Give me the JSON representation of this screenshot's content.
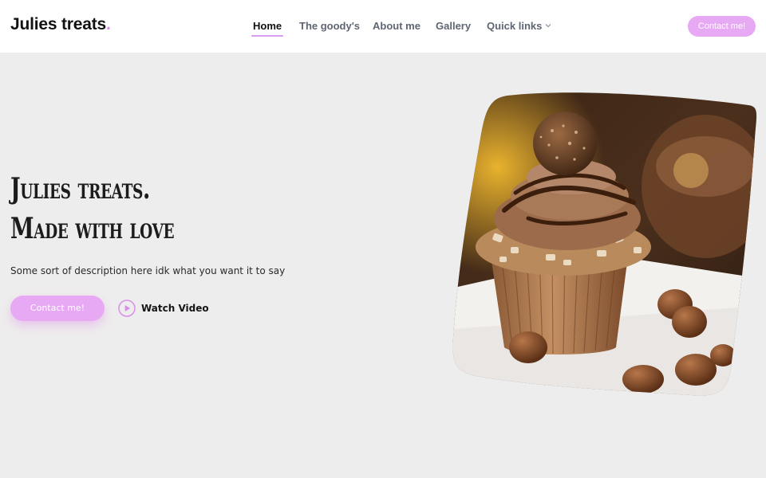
{
  "brand": {
    "name": "Julies treats",
    "dot": ".",
    "accent": "#d98de8"
  },
  "nav": {
    "items": [
      {
        "label": "Home",
        "active": true
      },
      {
        "label": "The goody's",
        "active": false
      },
      {
        "label": "About me",
        "active": false
      },
      {
        "label": "Gallery",
        "active": false
      },
      {
        "label": "Quick links",
        "active": false,
        "icon": "chevron-down-icon"
      }
    ]
  },
  "header": {
    "cta_label": "Contact me!"
  },
  "hero": {
    "title_line1": "Julies treats.",
    "title_line2": "Made with love",
    "description": "Some sort of description here idk what you want it to say",
    "cta_label": "Contact me!",
    "video_label": "Watch Video",
    "video_icon": "play-circle-icon",
    "image_subject": "chocolate hazelnut cupcake"
  },
  "colors": {
    "button": "#e7a9f3",
    "background": "#eeeded",
    "header": "#ffffff"
  }
}
